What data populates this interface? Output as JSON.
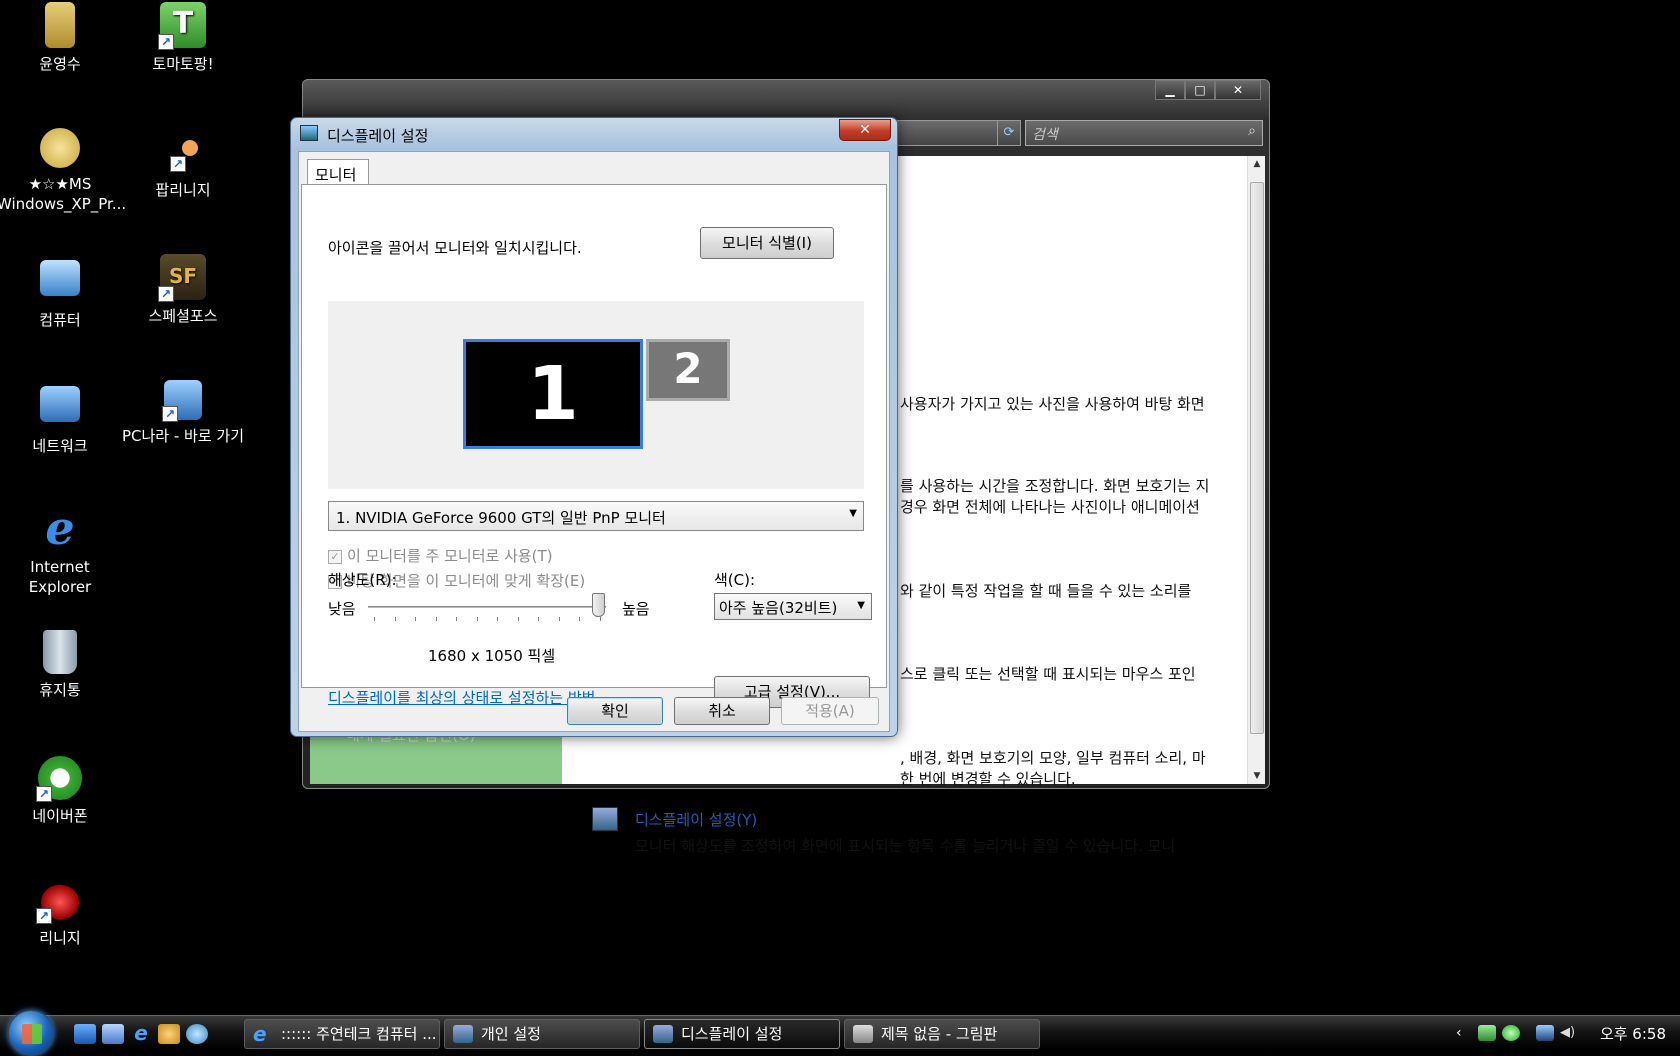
{
  "desktop_icons": [
    {
      "label": "윤영수",
      "icon": "folder-icon"
    },
    {
      "label": "토마토팡!",
      "icon": "tomatopang-icon"
    },
    {
      "label": "★☆★MS Windows_XP_Pr...",
      "icon": "iso-disc-icon"
    },
    {
      "label": "팝리니지",
      "icon": "popup-icon"
    },
    {
      "label": "컴퓨터",
      "icon": "computer-icon"
    },
    {
      "label": "스페셜포스",
      "icon": "specialforce-icon"
    },
    {
      "label": "네트워크",
      "icon": "network-icon"
    },
    {
      "label": "PC나라 - 바로 가기",
      "icon": "network-shortcut-icon"
    },
    {
      "label": "Internet Explorer",
      "icon": "ie-icon"
    },
    {
      "label": "휴지통",
      "icon": "recycle-bin-icon"
    },
    {
      "label": "네이버폰",
      "icon": "naverphone-icon"
    },
    {
      "label": "리니지",
      "icon": "lineage-icon"
    }
  ],
  "bg_window": {
    "search_placeholder": "검색",
    "descriptions": [
      "사용자가 가지고 있는 사진을 사용하여 바탕 화면",
      "를 사용하는 시간을 조정합니다. 화면 보호기는 지",
      "경우 화면 전체에 나타나는 사진이나 애니메이션",
      "와 같이 특정 작업을 할 때 들을 수 있는 소리를",
      "스로 클릭 또는 선택할 때 표시되는 마우스 포인",
      ", 배경, 화면 보호기의 모양, 일부 컴퓨터 소리, 마",
      "한 번에 변경할 수 있습니다."
    ],
    "display_link": "디스플레이 설정(Y)",
    "display_desc": "모니터 해상도를 조정하여 화면에 표시되는 항목 수를 늘리거나 줄일 수 있습니다. 모니",
    "left_item": "내게 필요한 옵션(O)"
  },
  "dialog": {
    "title": "디스플레이 설정",
    "close_label": "✕",
    "tab_label": "모니터",
    "instruction": "아이콘을 끌어서 모니터와 일치시킵니다.",
    "identify_button": "모니터 식별(I)",
    "monitors": [
      "1",
      "2"
    ],
    "monitor_select": "1.  NVIDIA GeForce 9600 GT의 일반 PnP 모니터",
    "checkbox_primary": "이 모니터를 주 모니터로 사용(T)",
    "checkbox_extend": "바탕 화면을 이 모니터에 맞게 확장(E)",
    "resolution_label": "해상도(R):",
    "low_label": "낮음",
    "high_label": "높음",
    "resolution_value": "1680 x 1050 픽셀",
    "resolution_slider_fraction": 1.0,
    "color_label": "색(C):",
    "color_value": "아주 높음(32비트)",
    "help_link": "디스플레이를 최상의 상태로 설정하는 방법",
    "advanced_button": "고급 설정(V)...",
    "ok_button": "확인",
    "cancel_button": "취소",
    "apply_button": "적용(A)"
  },
  "taskbar": {
    "buttons": [
      {
        "label": ":::::: 주연테크 컴퓨터 ...",
        "icon": "ie-icon"
      },
      {
        "label": "개인 설정",
        "icon": "control-panel-icon"
      },
      {
        "label": "디스플레이 설정",
        "icon": "display-settings-icon"
      },
      {
        "label": "제목 없음 - 그림판",
        "icon": "paint-icon"
      }
    ],
    "clock": "오후 6:58"
  },
  "colors": {
    "accent": "#3a7de0",
    "link": "#0066cc",
    "close_red": "#c23c25"
  }
}
